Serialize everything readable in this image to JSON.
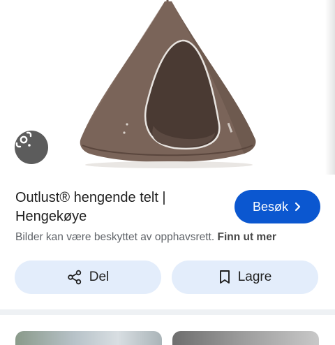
{
  "product": {
    "title_line1": "Outlust® hengende telt |",
    "title_line2": "Hengekøye"
  },
  "actions": {
    "visit_label": "Besøk",
    "share_label": "Del",
    "save_label": "Lagre"
  },
  "notice": {
    "text": "Bilder kan være beskyttet av opphavsrett.",
    "link": "Finn ut mer"
  },
  "icons": {
    "lens": "google-lens-icon",
    "share": "share-icon",
    "save": "bookmark-icon",
    "visit": "chevron-right-icon"
  },
  "colors": {
    "primary": "#0b57d0",
    "tonal_button": "#e3edfb",
    "tent": "#7a6459",
    "lens_bg": "#5c5c5c"
  }
}
